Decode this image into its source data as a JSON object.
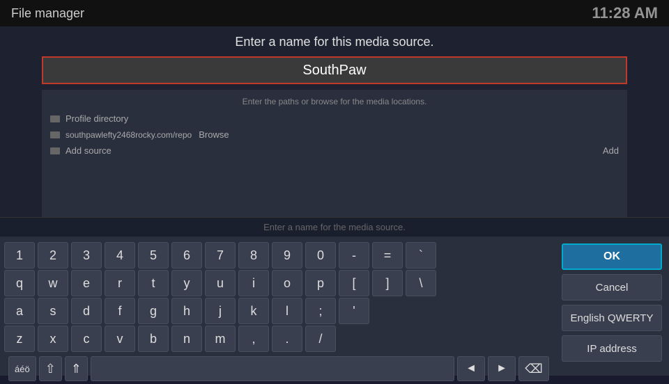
{
  "header": {
    "title": "File manager",
    "time": "11:28 AM"
  },
  "dialog": {
    "title": "Enter a name for this media source.",
    "input_value": "SouthPaw",
    "subtitle": "Enter the paths or browse for the media locations.",
    "source_path": "southpawlefty2468rocky.com/repo",
    "browse_label": "Browse",
    "add_label": "Add",
    "name_prompt": "Enter a name for the media source."
  },
  "sidebar": {
    "items": [
      {
        "label": "Profile directory"
      },
      {
        "label": "Add source"
      }
    ]
  },
  "keyboard": {
    "rows": [
      [
        "1",
        "2",
        "3",
        "4",
        "5",
        "6",
        "7",
        "8",
        "9",
        "0",
        "-",
        "=",
        "`"
      ],
      [
        "q",
        "w",
        "e",
        "r",
        "t",
        "y",
        "u",
        "i",
        "o",
        "p",
        "[",
        "]",
        "\\"
      ],
      [
        "a",
        "s",
        "d",
        "f",
        "g",
        "h",
        "j",
        "k",
        "l",
        ";",
        "'"
      ],
      [
        "z",
        "x",
        "c",
        "v",
        "b",
        "n",
        "m",
        ",",
        ".",
        "/"
      ]
    ],
    "special_keys": {
      "accent": "áéö",
      "shift_icon": "⇧",
      "caps_icon": "⇑",
      "prev": "◄",
      "next": "►",
      "backspace": "⌫"
    },
    "side_buttons": [
      {
        "label": "OK",
        "is_ok": true
      },
      {
        "label": "Cancel"
      },
      {
        "label": "English QWERTY"
      },
      {
        "label": "IP address"
      }
    ]
  },
  "colors": {
    "ok_border": "#00aacc",
    "ok_bg": "#1e6fa0",
    "input_border": "#c0392b"
  }
}
